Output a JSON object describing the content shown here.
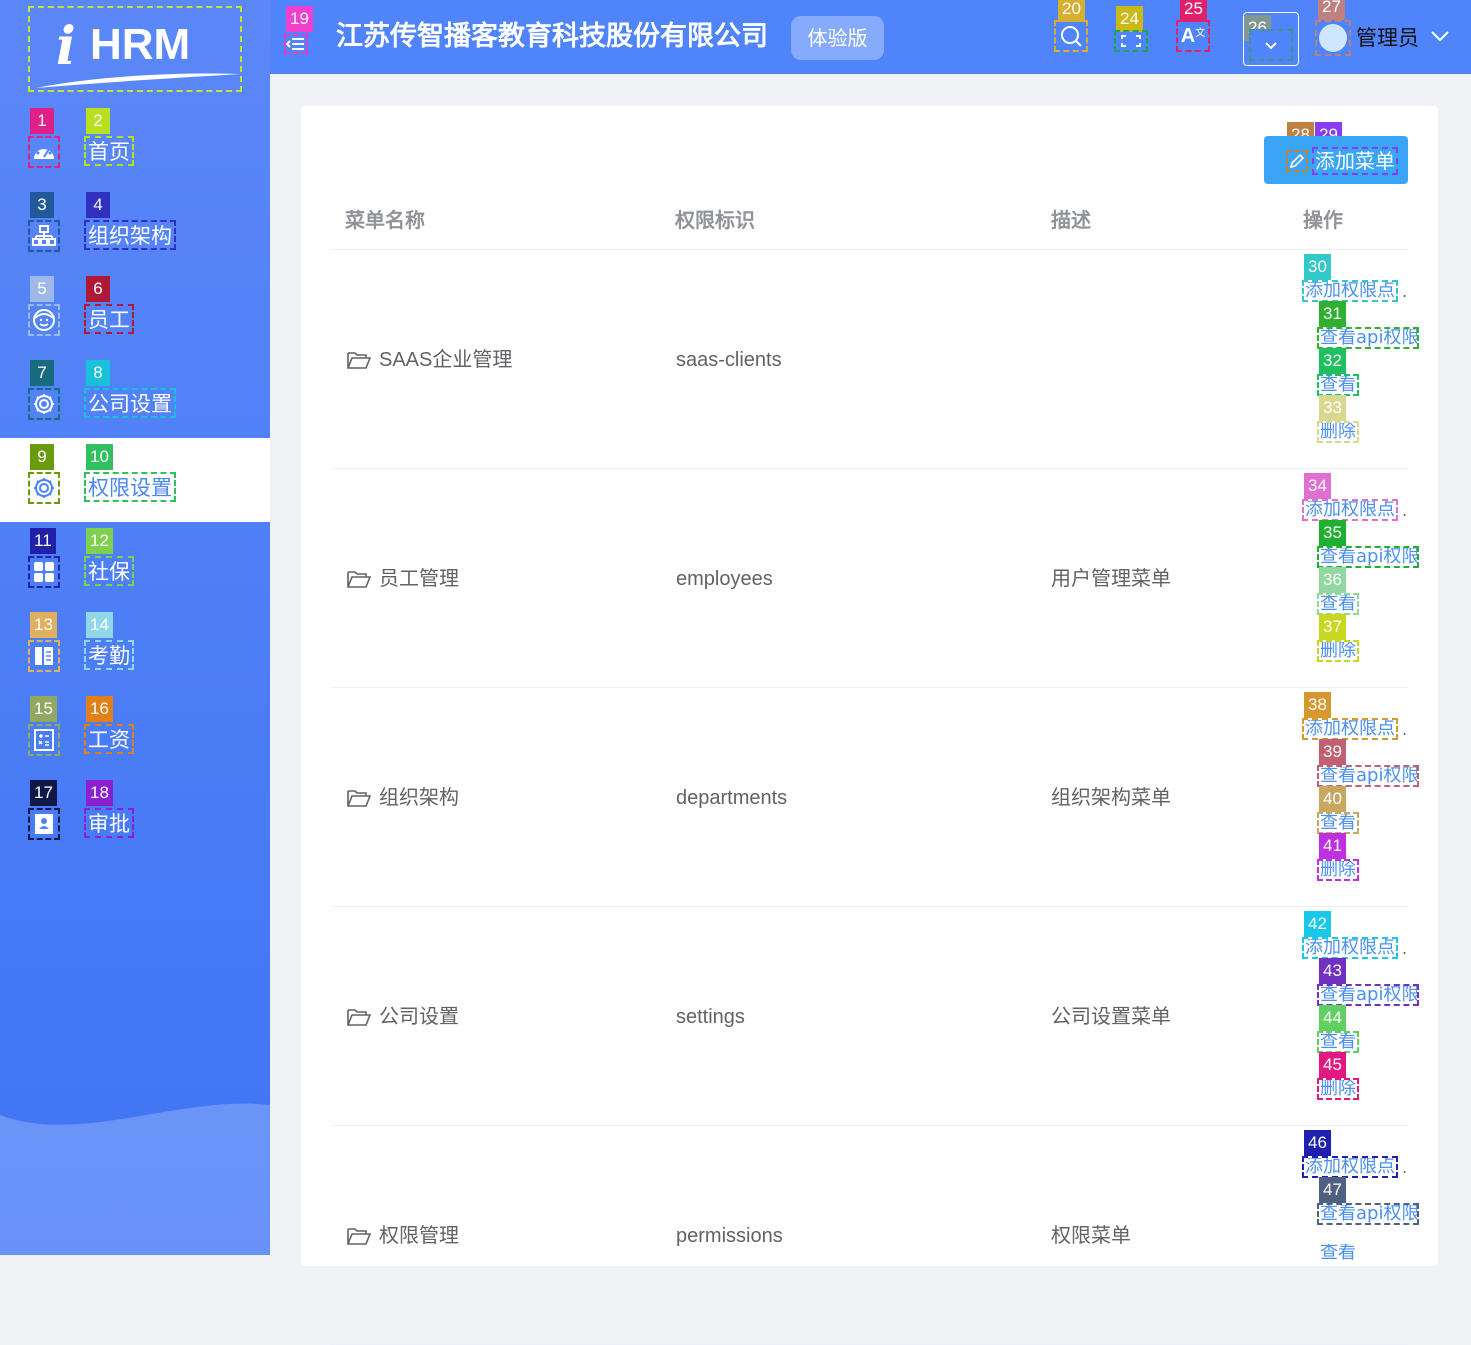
{
  "sidebar": {
    "logo_text": "HRM",
    "logo_letter": "i",
    "items": [
      {
        "label": "首页",
        "icon": "dashboard-icon",
        "icon_badge": "1",
        "label_badge": "2",
        "icon_color": "#e0208a",
        "label_color": "#b8e020",
        "active": false
      },
      {
        "label": "组织架构",
        "icon": "org-chart-icon",
        "icon_badge": "3",
        "label_badge": "4",
        "icon_color": "#205a9a",
        "label_color": "#3030c0",
        "active": false
      },
      {
        "label": "员工",
        "icon": "employee-face-icon",
        "icon_badge": "5",
        "label_badge": "6",
        "icon_color": "#a0b8e8",
        "label_color": "#b01838",
        "active": false
      },
      {
        "label": "公司设置",
        "icon": "gear-icon",
        "icon_badge": "7",
        "label_badge": "8",
        "icon_color": "#186a80",
        "label_color": "#18c0d8",
        "active": false
      },
      {
        "label": "权限设置",
        "icon": "gear-icon",
        "icon_badge": "9",
        "label_badge": "10",
        "icon_color": "#6a9a10",
        "label_color": "#30c060",
        "active": true
      },
      {
        "label": "社保",
        "icon": "grid-apps-icon",
        "icon_badge": "11",
        "label_badge": "12",
        "icon_color": "#2020a8",
        "label_color": "#80d050",
        "active": false
      },
      {
        "label": "考勤",
        "icon": "book-icon",
        "icon_badge": "13",
        "label_badge": "14",
        "icon_color": "#e0b060",
        "label_color": "#90d8e8",
        "active": false
      },
      {
        "label": "工资",
        "icon": "calculator-icon",
        "icon_badge": "15",
        "label_badge": "16",
        "icon_color": "#90a860",
        "label_color": "#e08018",
        "active": false
      },
      {
        "label": "审批",
        "icon": "contact-card-icon",
        "icon_badge": "17",
        "label_badge": "18",
        "icon_color": "#101848",
        "label_color": "#8a20d0",
        "active": false
      }
    ]
  },
  "header": {
    "hamburger_badge": "19",
    "company_name": "江苏传智播客教育科技股份有限公司",
    "edition_label": "体验版",
    "tools": [
      {
        "icon": "search-icon",
        "badge": "20",
        "color": "#d8b030"
      },
      {
        "icon": "fullscreen-icon",
        "badge": "24",
        "color": "#20a060"
      },
      {
        "icon": "translate-icon",
        "badge": "25",
        "color": "#e0206a"
      }
    ],
    "theme_badge": "26",
    "avatar_badge": "27",
    "user_name": "管理员"
  },
  "toolbar": {
    "add_menu_label": "添加菜单",
    "pen_badge": "28",
    "label_badge": "29"
  },
  "table": {
    "columns": [
      "菜单名称",
      "权限标识",
      "描述",
      "操作"
    ],
    "rows": [
      {
        "name": "SAAS企业管理",
        "code": "saas-clients",
        "desc": "",
        "badges": [
          "30",
          "31",
          "32",
          "33"
        ],
        "colors": [
          "#30c8c8",
          "#30b030",
          "#20c060",
          "#d8d890"
        ]
      },
      {
        "name": "员工管理",
        "code": "employees",
        "desc": "用户管理菜单",
        "badges": [
          "34",
          "35",
          "36",
          "37"
        ],
        "colors": [
          "#e070d0",
          "#20b030",
          "#90d8a0",
          "#c8d820"
        ]
      },
      {
        "name": "组织架构",
        "code": "departments",
        "desc": "组织架构菜单",
        "badges": [
          "38",
          "39",
          "40",
          "41"
        ],
        "colors": [
          "#d89830",
          "#c06070",
          "#c8a860",
          "#c030e0"
        ]
      },
      {
        "name": "公司设置",
        "code": "settings",
        "desc": "公司设置菜单",
        "badges": [
          "42",
          "43",
          "44",
          "45"
        ],
        "colors": [
          "#18c8e8",
          "#7030c0",
          "#60d060",
          "#e01880"
        ]
      },
      {
        "name": "权限管理",
        "code": "permissions",
        "desc": "权限菜单",
        "badges": [
          "46",
          "47"
        ],
        "colors": [
          "#2020b0",
          "#506080"
        ]
      }
    ],
    "op_labels": {
      "add_point": "添加权限点",
      "view_api": "查看api权限",
      "view": "查看",
      "delete": "删除"
    },
    "overflow_dots": ".",
    "cut_off_label": "查看"
  },
  "colors": {
    "sidebar_top": "#5b88f8",
    "header_bg": "#4f84fb",
    "link": "#4a90f0",
    "primary_button": "#3aa4f5"
  }
}
